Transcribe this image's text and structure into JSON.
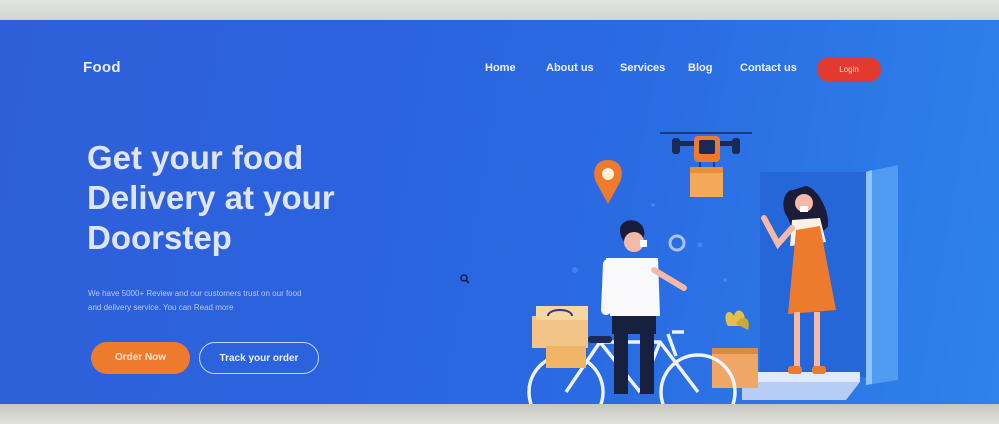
{
  "header": {
    "logo": "Food",
    "nav": [
      "Home",
      "About us",
      "Services",
      "Blog",
      "Contact us"
    ],
    "login_label": "Login"
  },
  "hero": {
    "title_lines": [
      "Get your food",
      "Delivery at your",
      "Doorstep"
    ],
    "description_lines": [
      "We have 5000+ Review and our customers trust on our food",
      "and delivery service. You can Read more"
    ],
    "order_label": "Order Now",
    "track_label": "Track your order"
  },
  "colors": {
    "background": "#2b63de",
    "login_button": "#e33a2f",
    "order_button": "#ee7a2d",
    "accent_orange": "#ee7a2d"
  },
  "icons": [
    "location-pin-icon",
    "drone-icon",
    "cursor-icon"
  ]
}
